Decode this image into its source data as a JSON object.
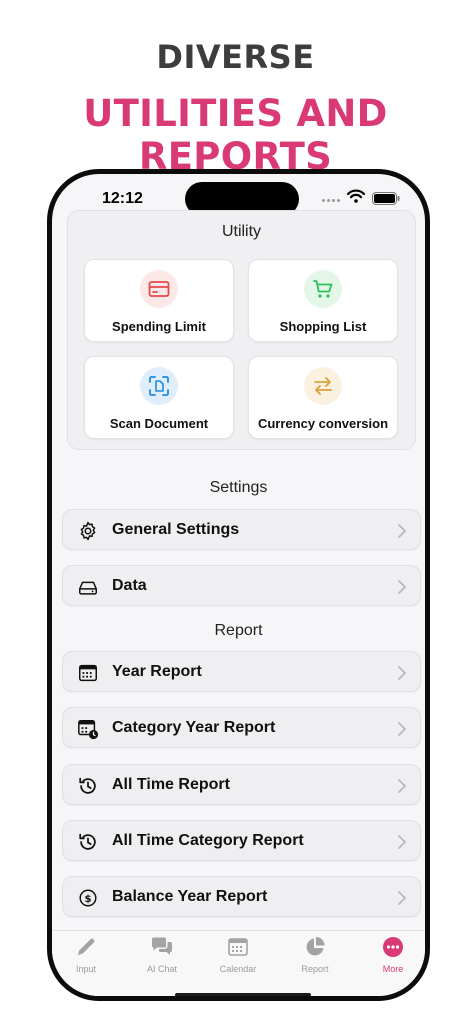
{
  "promo": {
    "line1": "DIVERSE",
    "line2": "UTILITIES AND REPORTS"
  },
  "status": {
    "time": "12:12"
  },
  "utility": {
    "title": "Utility",
    "cards": [
      {
        "label": "Spending Limit",
        "icon": "credit-card-icon",
        "color": "#e5484d",
        "bg": "#fde8e8"
      },
      {
        "label": "Shopping List",
        "icon": "cart-icon",
        "color": "#2bbf5a",
        "bg": "#e3f6e8"
      },
      {
        "label": "Scan Document",
        "icon": "scan-document-icon",
        "color": "#1f8ae0",
        "bg": "#e0eefb"
      },
      {
        "label": "Currency conversion",
        "icon": "exchange-arrows-icon",
        "color": "#d9a23a",
        "bg": "#fbf1e0"
      }
    ]
  },
  "settings": {
    "title": "Settings",
    "items": [
      {
        "label": "General Settings",
        "icon": "gear-icon"
      },
      {
        "label": "Data",
        "icon": "drive-icon"
      }
    ]
  },
  "report": {
    "title": "Report",
    "items": [
      {
        "label": "Year Report",
        "icon": "calendar-icon"
      },
      {
        "label": "Category Year Report",
        "icon": "calendar-clock-icon"
      },
      {
        "label": "All Time Report",
        "icon": "history-icon"
      },
      {
        "label": "All Time Category Report",
        "icon": "history-icon"
      },
      {
        "label": "Balance Year Report",
        "icon": "dollar-circle-icon"
      }
    ]
  },
  "tabs": [
    {
      "label": "Input",
      "icon": "pencil-icon",
      "active": false
    },
    {
      "label": "AI Chat",
      "icon": "chat-bubbles-icon",
      "active": false
    },
    {
      "label": "Calendar",
      "icon": "calendar-grid-icon",
      "active": false
    },
    {
      "label": "Report",
      "icon": "pie-chart-icon",
      "active": false
    },
    {
      "label": "More",
      "icon": "more-dots-icon",
      "active": true
    }
  ],
  "colors": {
    "accent": "#d93a76",
    "promo_dark": "#3d3d3d"
  }
}
